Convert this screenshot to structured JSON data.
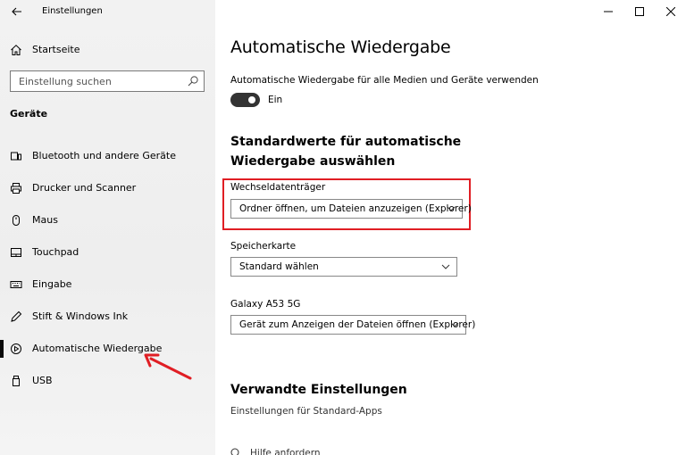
{
  "window": {
    "title": "Einstellungen"
  },
  "sidebar": {
    "home_label": "Startseite",
    "search_placeholder": "Einstellung suchen",
    "group_title": "Geräte",
    "items": [
      {
        "label": "Bluetooth und andere Geräte",
        "icon": "bluetooth-icon"
      },
      {
        "label": "Drucker und Scanner",
        "icon": "printer-icon"
      },
      {
        "label": "Maus",
        "icon": "mouse-icon"
      },
      {
        "label": "Touchpad",
        "icon": "touchpad-icon"
      },
      {
        "label": "Eingabe",
        "icon": "keyboard-icon"
      },
      {
        "label": "Stift & Windows Ink",
        "icon": "pen-icon"
      },
      {
        "label": "Automatische Wiedergabe",
        "icon": "autoplay-icon",
        "selected": true
      },
      {
        "label": "USB",
        "icon": "usb-icon"
      }
    ]
  },
  "main": {
    "title": "Automatische Wiedergabe",
    "toggle_label": "Automatische Wiedergabe für alle Medien und Geräte verwenden",
    "toggle_state": "Ein",
    "toggle_on": true,
    "defaults_title": "Standardwerte für automatische Wiedergabe auswählen",
    "fields": [
      {
        "label": "Wechseldatenträger",
        "value": "Ordner öffnen, um Dateien anzuzeigen (Explorer)"
      },
      {
        "label": "Speicherkarte",
        "value": "Standard wählen"
      },
      {
        "label": "Galaxy A53 5G",
        "value": "Gerät zum Anzeigen der Dateien öffnen (Explorer)"
      }
    ],
    "related_title": "Verwandte Einstellungen",
    "related_link": "Einstellungen für Standard-Apps",
    "help_label": "Hilfe anfordern"
  },
  "colors": {
    "sidebar_bg": "#f2f2f2",
    "toggle_on": "#333333",
    "annotation_red": "#e01e24"
  }
}
